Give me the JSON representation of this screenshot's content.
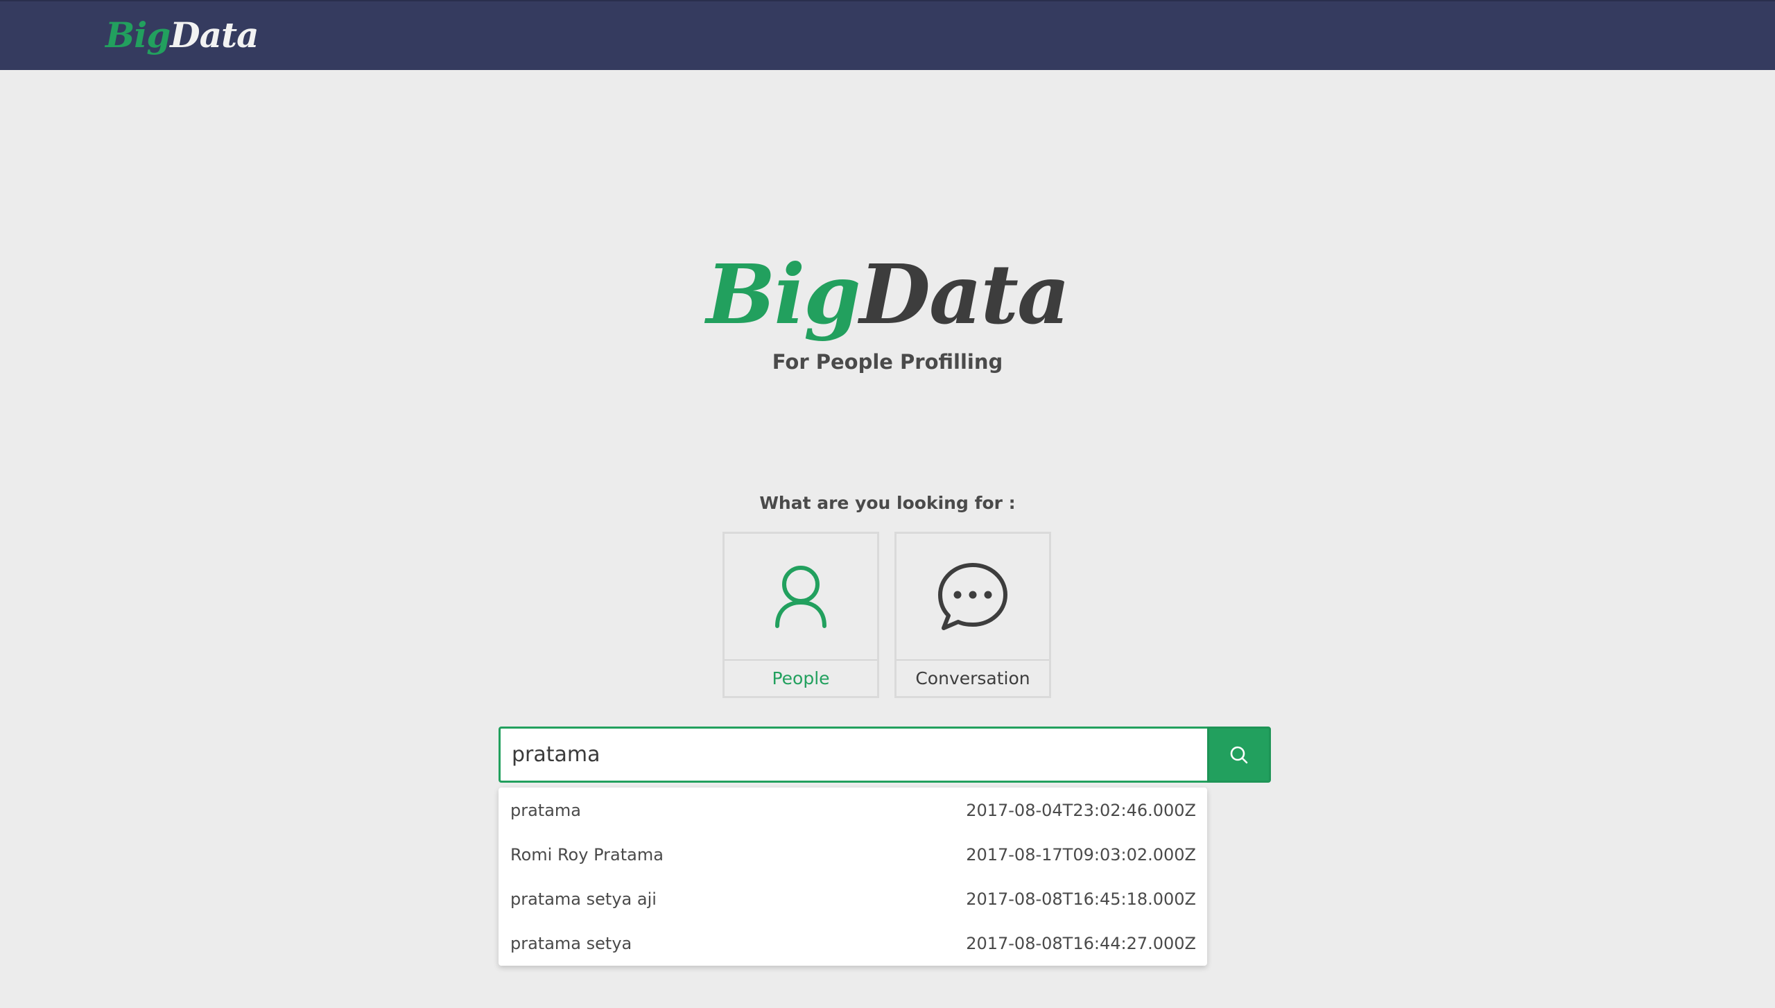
{
  "navbar": {
    "logo_big": "Big",
    "logo_data": "Data"
  },
  "hero": {
    "logo_big": "Big",
    "logo_data": "Data",
    "tagline": "For People Profilling"
  },
  "category_prompt": "What are you looking for :",
  "categories": [
    {
      "label": "People",
      "icon": "person-icon",
      "selected": true
    },
    {
      "label": "Conversation",
      "icon": "chat-bubble-icon",
      "selected": false
    }
  ],
  "search": {
    "value": "pratama",
    "button_icon": "search-icon"
  },
  "suggestions": [
    {
      "name": "pratama",
      "timestamp": "2017-08-04T23:02:46.000Z"
    },
    {
      "name": "Romi Roy Pratama",
      "timestamp": "2017-08-17T09:03:02.000Z"
    },
    {
      "name": "pratama setya aji",
      "timestamp": "2017-08-08T16:45:18.000Z"
    },
    {
      "name": "pratama setya",
      "timestamp": "2017-08-08T16:44:27.000Z"
    }
  ],
  "colors": {
    "brand_green": "#22a05e",
    "navbar_bg": "#353b5f",
    "page_bg": "#ececec",
    "text_dark": "#4a4a4a"
  }
}
